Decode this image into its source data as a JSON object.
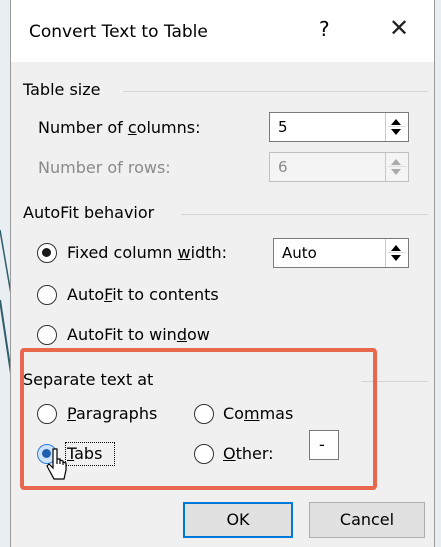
{
  "dialog": {
    "title": "Convert Text to Table",
    "help_label": "?",
    "close_label": "✕"
  },
  "table_size": {
    "section_label": "Table size",
    "columns": {
      "label_pre": "Number of ",
      "label_accel": "c",
      "label_post": "olumns:",
      "value": "5"
    },
    "rows": {
      "label": "Number of rows:",
      "value": "6"
    }
  },
  "autofit": {
    "section_label": "AutoFit behavior",
    "fixed": {
      "label_pre": "Fixed column ",
      "label_accel": "w",
      "label_post": "idth:",
      "value": "Auto",
      "checked": true
    },
    "contents": {
      "label_pre": "Auto",
      "label_accel": "F",
      "label_post": "it to contents",
      "checked": false
    },
    "window": {
      "label_pre": "AutoFit to win",
      "label_accel": "d",
      "label_post": "ow",
      "checked": false
    }
  },
  "separate": {
    "section_label": "Separate text at",
    "paragraphs": {
      "label_pre": "",
      "label_accel": "P",
      "label_post": "aragraphs",
      "checked": false
    },
    "commas": {
      "label_pre": "Co",
      "label_accel": "m",
      "label_post": "mas",
      "checked": false
    },
    "tabs": {
      "label_pre": "",
      "label_accel": "T",
      "label_post": "abs",
      "checked": true
    },
    "other": {
      "label_pre": "",
      "label_accel": "O",
      "label_post": "ther:",
      "checked": false,
      "value": "-"
    }
  },
  "buttons": {
    "ok": "OK",
    "cancel": "Cancel"
  },
  "colors": {
    "highlight": "#e9674d",
    "accent": "#0078d7"
  }
}
